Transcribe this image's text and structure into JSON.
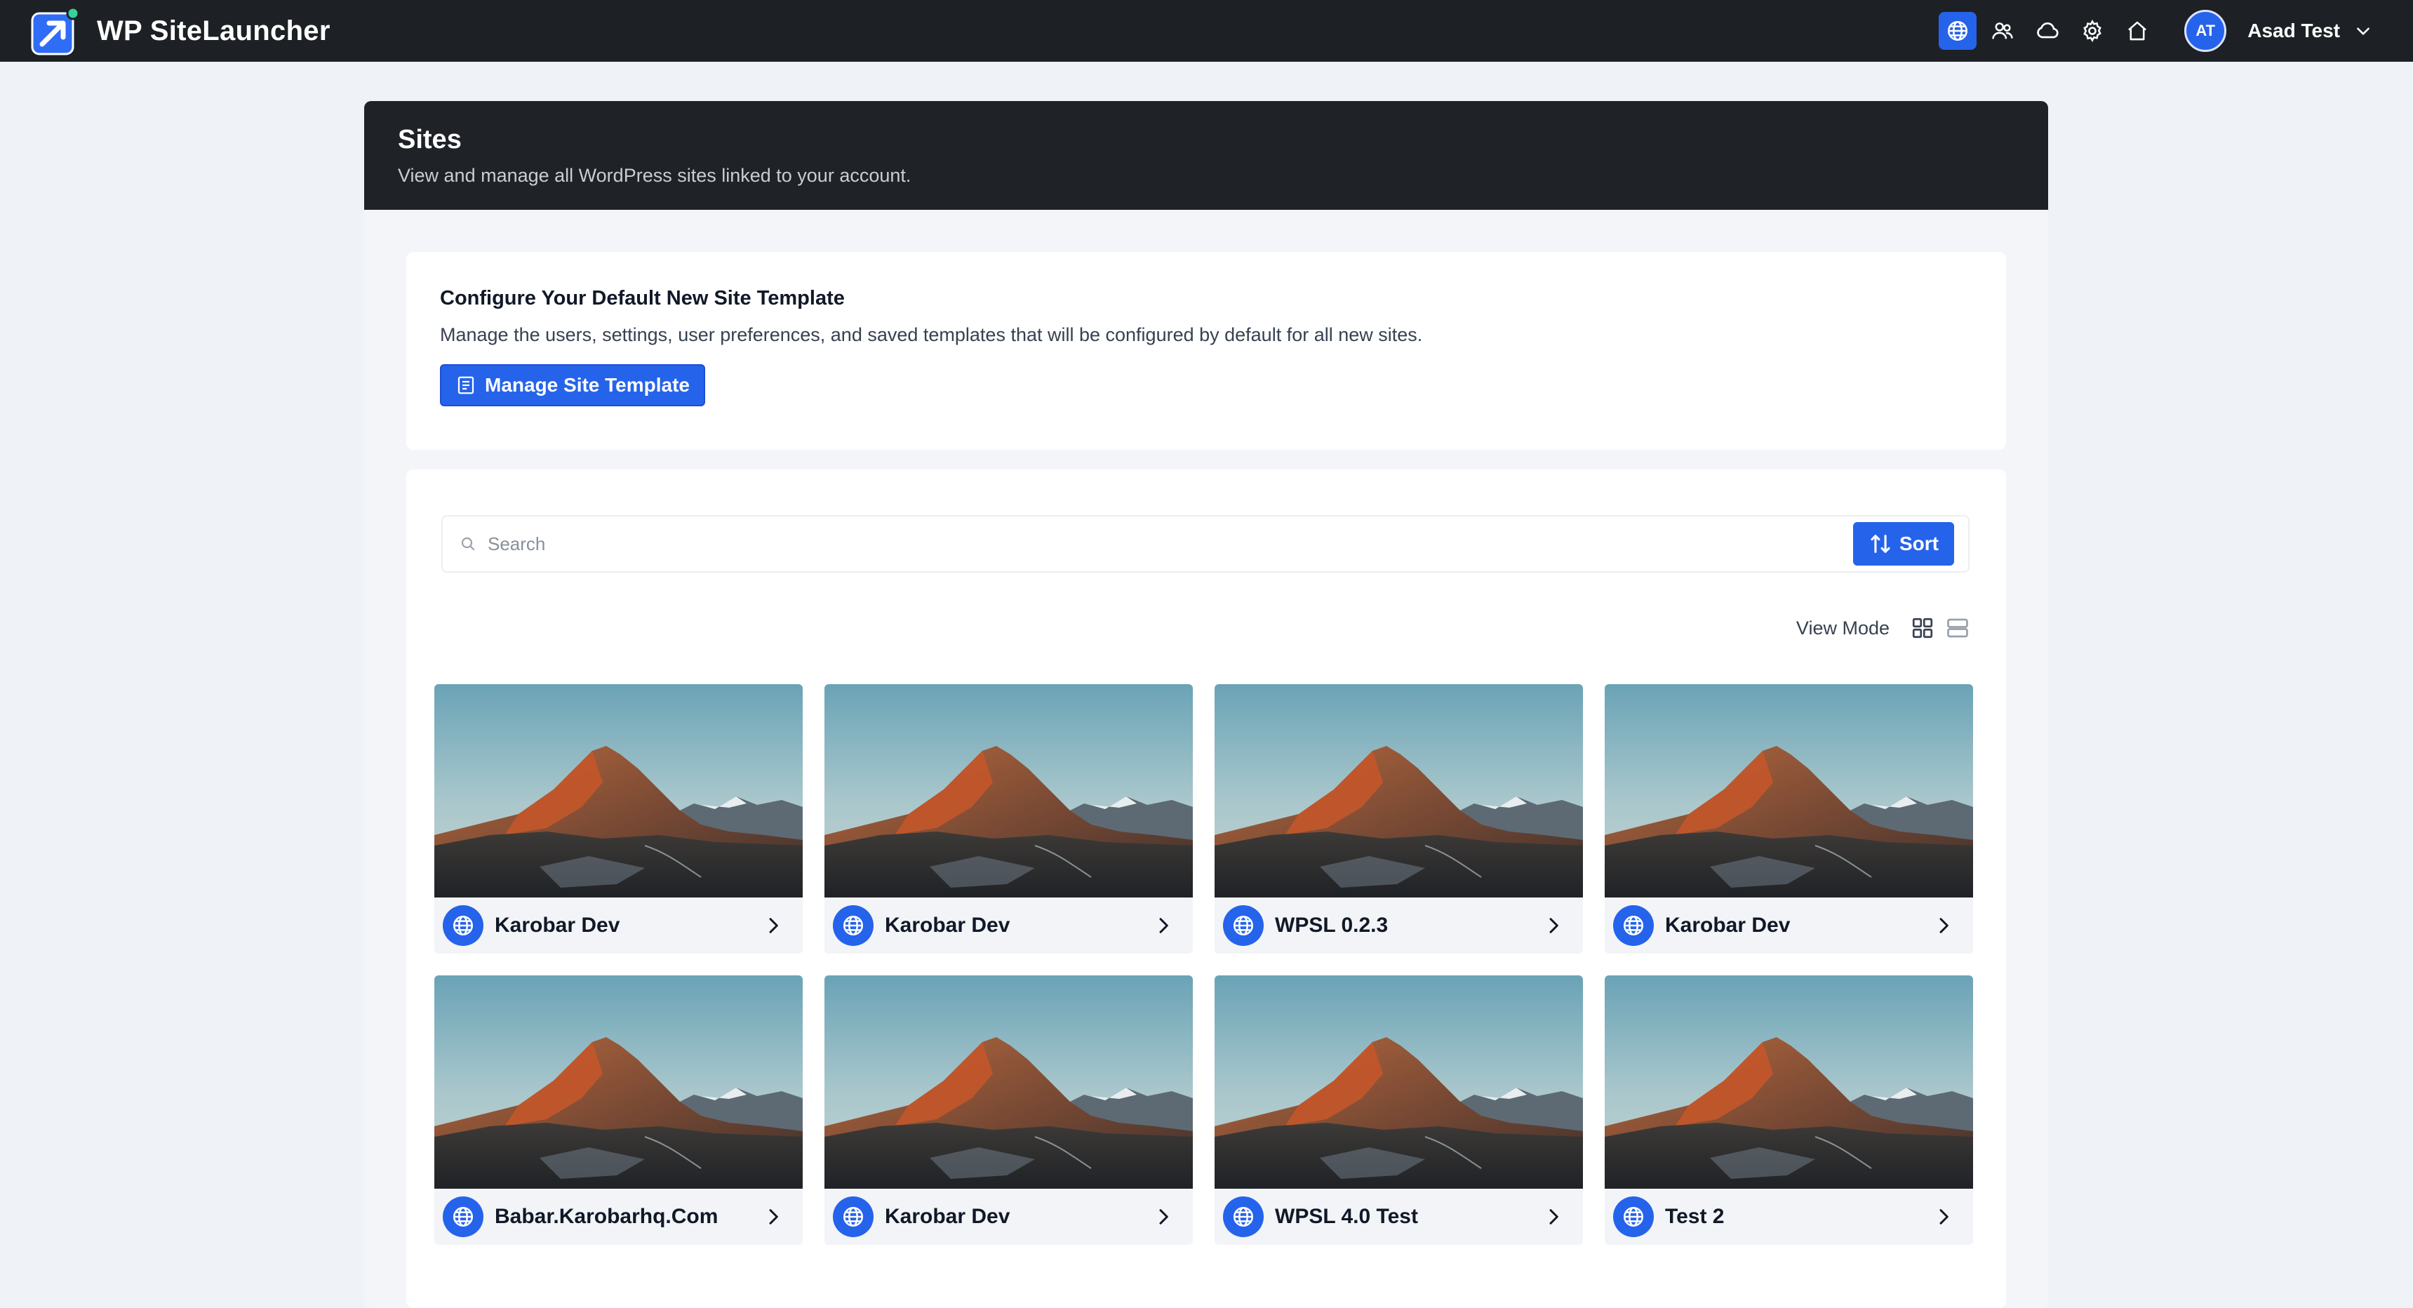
{
  "app": {
    "name": "WP SiteLauncher",
    "accent_color": "#2563eb",
    "topbar_bg": "#1d2024"
  },
  "topbar": {
    "icons": [
      "globe-icon",
      "users-icon",
      "cloud-icon",
      "gear-icon",
      "home-icon"
    ],
    "user": {
      "initials": "AT",
      "name": "Asad Test"
    }
  },
  "page": {
    "title": "Sites",
    "subtitle": "View and manage all WordPress sites linked to your account."
  },
  "template_section": {
    "title": "Configure Your Default New Site Template",
    "description": "Manage the users, settings, user preferences, and saved templates that will be configured by default for all new sites.",
    "button_label": "Manage Site Template"
  },
  "search": {
    "placeholder": "Search",
    "value": ""
  },
  "sort": {
    "label": "Sort"
  },
  "view_mode": {
    "label": "View Mode",
    "options": [
      "grid-view-icon",
      "list-view-icon"
    ],
    "selected": "grid"
  },
  "sites": [
    {
      "name": "Karobar Dev"
    },
    {
      "name": "Karobar Dev"
    },
    {
      "name": "WPSL 0.2.3"
    },
    {
      "name": "Karobar Dev"
    },
    {
      "name": "Babar.Karobarhq.Com"
    },
    {
      "name": "Karobar Dev"
    },
    {
      "name": "WPSL 4.0 Test"
    },
    {
      "name": "Test 2"
    }
  ]
}
